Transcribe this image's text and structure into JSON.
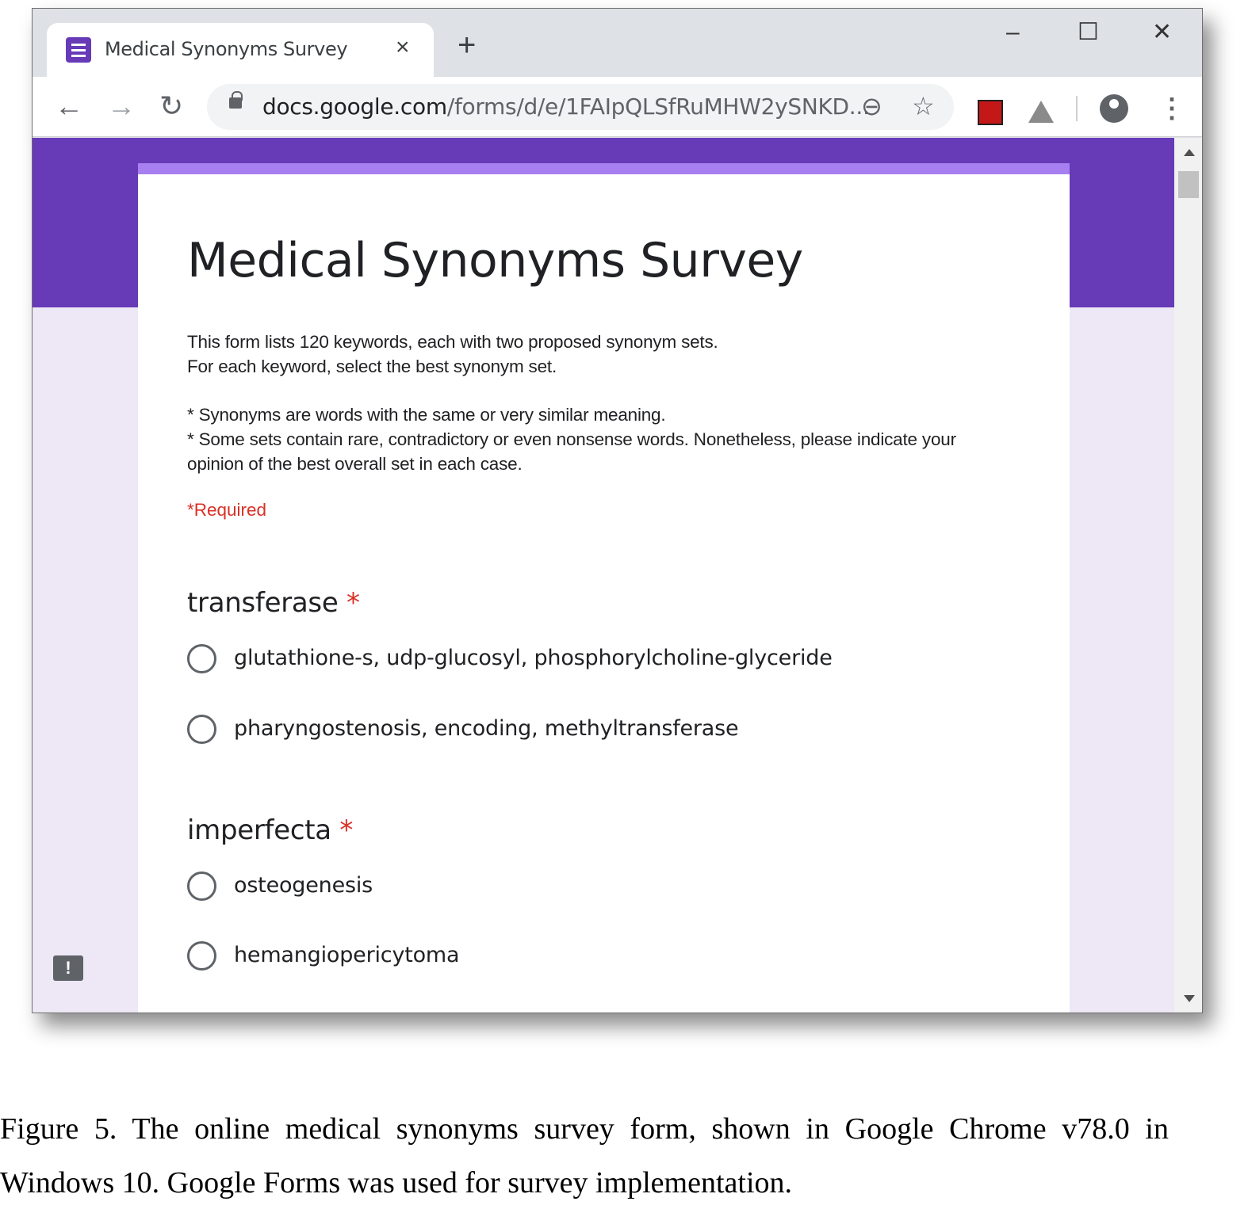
{
  "browser": {
    "tab": {
      "title": "Medical Synonyms Survey",
      "close_icon": "×"
    },
    "new_tab_icon": "+",
    "window_controls": {
      "minimize": "–",
      "maximize": "☐",
      "close": "✕"
    },
    "nav": {
      "back": "←",
      "forward": "→",
      "reload": "↻"
    },
    "address_bar": {
      "url_host": "docs.google.com",
      "url_path": "/forms/d/e/1FAIpQLSfRuMHW2ySNKD..."
    },
    "zoom_icon": "⊖",
    "bookmark_icon": "☆",
    "menu_icon": "⋮"
  },
  "form": {
    "title": "Medical Synonyms Survey",
    "description": [
      "This form lists 120 keywords, each with two proposed synonym sets.",
      "For each keyword, select the best synonym set.",
      "* Synonyms are words with the same or very similar meaning.",
      "* Some sets contain rare, contradictory or even nonsense words. Nonetheless, please indicate your",
      "opinion of the best overall set in each case."
    ],
    "required_note": "*Required",
    "questions": [
      {
        "keyword": "transferase",
        "required_mark": "*",
        "options": [
          "glutathione-s, udp-glucosyl, phosphorylcholine-glyceride",
          "pharyngostenosis, encoding, methyltransferase"
        ]
      },
      {
        "keyword": "imperfecta",
        "required_mark": "*",
        "options": [
          "osteogenesis",
          "hemangiopericytoma"
        ]
      }
    ],
    "feedback_icon": "!"
  },
  "caption": {
    "line1": "Figure 5. The online medical synonyms survey form, shown in Google Chrome v78.0 in",
    "line2": "Windows 10. Google Forms was used for survey implementation."
  },
  "colors": {
    "header_purple": "#673ab7",
    "card_accent": "#a77ff0",
    "page_background": "#ede7f6",
    "required_red": "#d93025"
  }
}
